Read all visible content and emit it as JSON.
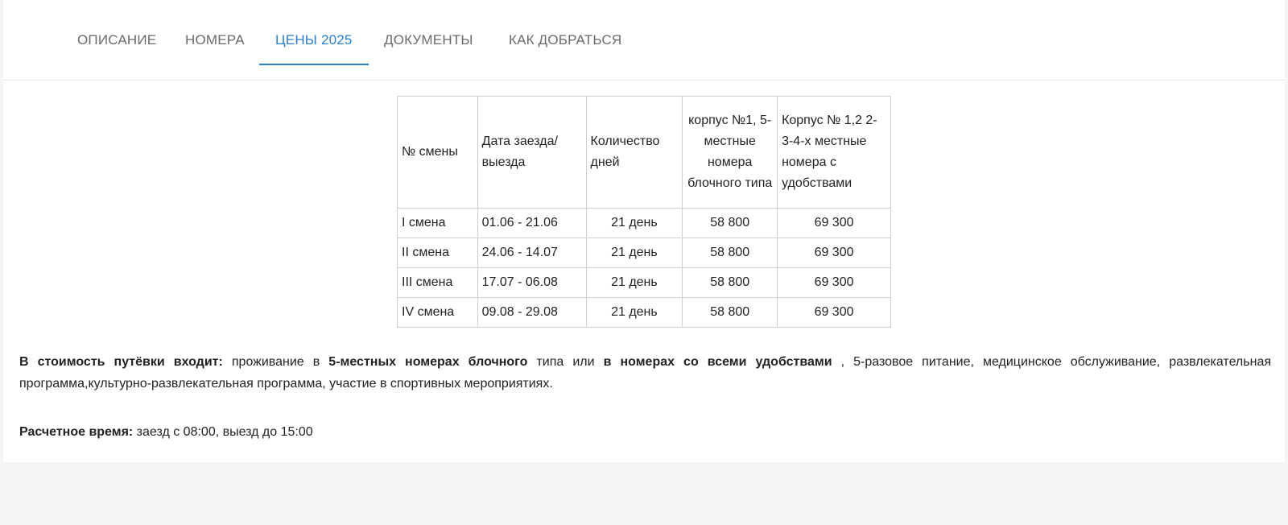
{
  "tabs": [
    {
      "label": "ОПИСАНИЕ",
      "active": false
    },
    {
      "label": "НОМЕРА",
      "active": false
    },
    {
      "label": "ЦЕНЫ 2025",
      "active": true
    },
    {
      "label": "ДОКУМЕНТЫ",
      "active": false
    },
    {
      "label": "КАК ДОБРАТЬСЯ",
      "active": false
    }
  ],
  "accent_color": "#2a7fd0",
  "table": {
    "headers": [
      "№ смены",
      "Дата заезда/ выезда",
      "Количество дней",
      "корпус №1, 5-местные номера блочного типа",
      "Корпус № 1,2 2-3-4-х местные номера с удобствами"
    ],
    "rows": [
      [
        "I смена",
        "01.06 - 21.06",
        "21 день",
        "58 800",
        "69 300"
      ],
      [
        "II смена",
        "24.06 - 14.07",
        "21 день",
        "58 800",
        "69 300"
      ],
      [
        "III смена",
        "17.07 - 06.08",
        "21 день",
        "58 800",
        "69 300"
      ],
      [
        "IV смена",
        "09.08 - 29.08",
        "21 день",
        "58 800",
        "69 300"
      ]
    ]
  },
  "info": {
    "label": "В стоимость путёвки входит:",
    "t1": " проживание в ",
    "b1": "5-местных номерах блочного",
    "t2": " типа или ",
    "b2": "в номерах со всеми удобствами",
    "t3": " , 5-разовое питание, медицинское обслуживание, развлекательная программа,культурно-развлекательная программа, участие в спортивных мероприятиях."
  },
  "checkin": {
    "label": "Расчетное время:",
    "value": " заезд с 08:00, выезд до 15:00"
  }
}
